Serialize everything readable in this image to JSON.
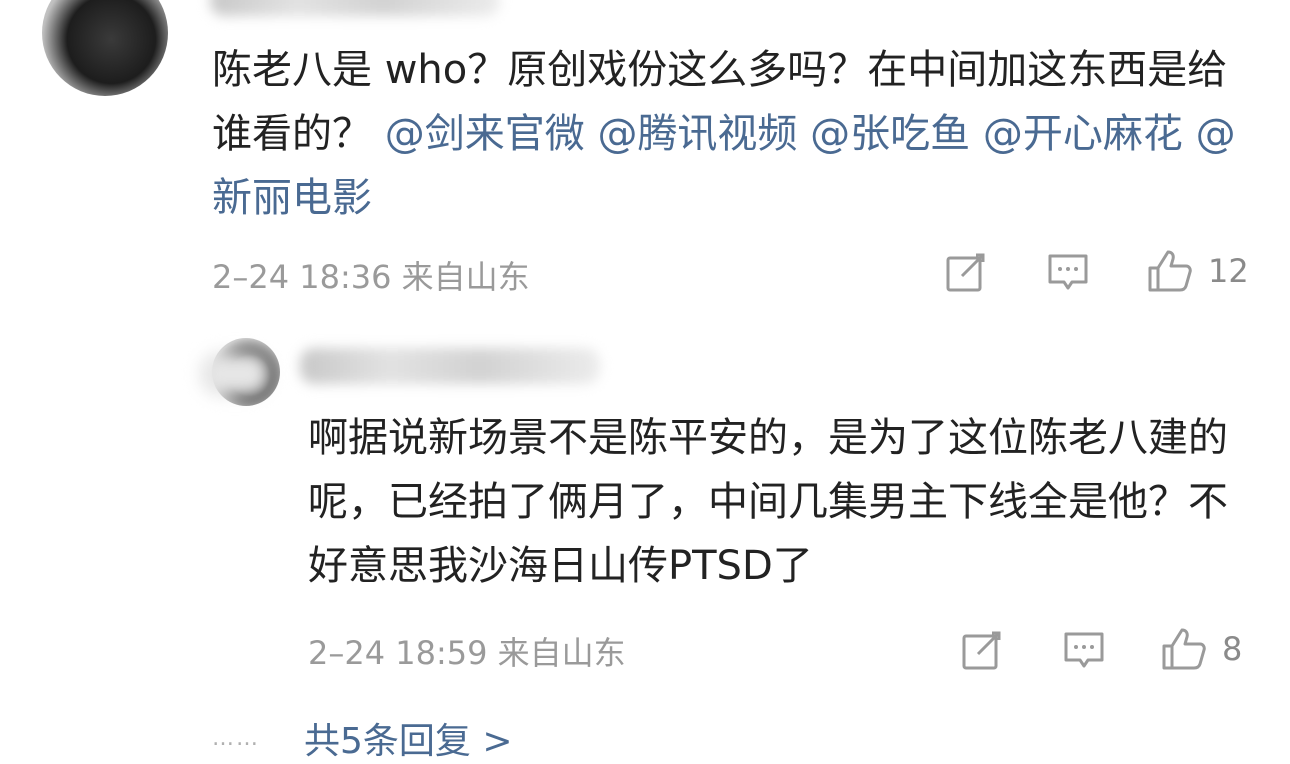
{
  "main_comment": {
    "text_parts": [
      {
        "text": "陈老八是 who？原创戏份这么多吗？在中间加这东西是给谁看的？ ",
        "type": "plain"
      },
      {
        "text": "@剑来官微",
        "type": "mention"
      },
      {
        "text": " ",
        "type": "plain"
      },
      {
        "text": "@腾讯视频",
        "type": "mention"
      },
      {
        "text": " ",
        "type": "plain"
      },
      {
        "text": "@张吃鱼",
        "type": "mention"
      },
      {
        "text": " ",
        "type": "plain"
      },
      {
        "text": "@开心麻花",
        "type": "mention"
      },
      {
        "text": " ",
        "type": "plain"
      },
      {
        "text": "@新丽电影",
        "type": "mention"
      }
    ],
    "meta": "2–24 18:36 来自山东",
    "like_count": "12",
    "icons": [
      "edit-icon",
      "comment-icon",
      "thumbs-up-icon"
    ]
  },
  "reply": {
    "text": "啊据说新场景不是陈平安的，是为了这位陈老八建的呢，已经拍了俩月了，中间几集男主下线全是他？不好意思我沙海日山传PTSD了",
    "meta": "2–24 18:59 来自山东",
    "like_count": "8",
    "icons": [
      "edit-icon",
      "comment-icon",
      "thumbs-up-icon"
    ]
  },
  "more_replies": {
    "dots": "……",
    "label": "共5条回复 >"
  },
  "colors": {
    "text": "#222222",
    "meta": "#9a9a9a",
    "mention": "#4a6a92"
  }
}
